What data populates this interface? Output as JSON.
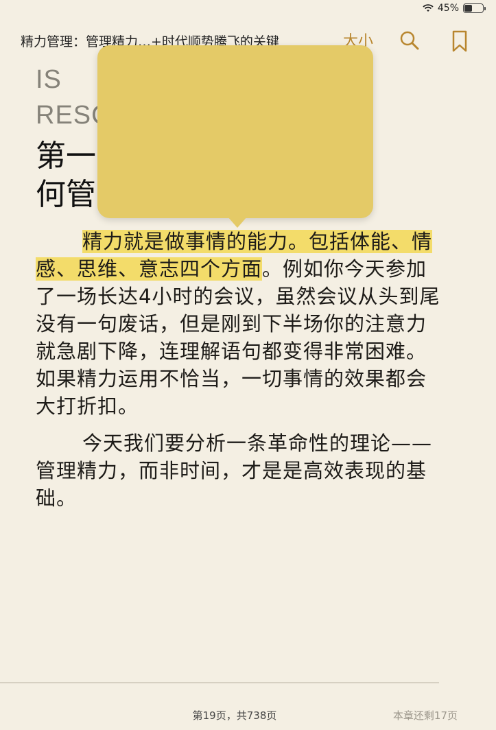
{
  "status": {
    "battery": "45%",
    "battery_level": 0.45
  },
  "header": {
    "book_title": "精力管理：管理精力…+时代顺势腾飞的关键",
    "font_size_label": "大小",
    "search_icon": "search-icon",
    "bookmark_icon": "bookmark-icon",
    "accent_color": "#b8862e"
  },
  "chapter": {
    "en_line1": "IS              IOUS",
    "en_line2": "RESC",
    "title_line1": "第一                  及如",
    "title_line2": "何管"
  },
  "body": {
    "p1_highlight": "精力就是做事情的能力。包括体能、情感、思维、意志四个方面",
    "p1_rest": "。例如你今天参加了一场长达4小时的会议，虽然会议从头到尾没有一句废话，但是刚到下半场你的注意力就急剧下降，连理解语句都变得非常困难。如果精力运用不恰当，一切事情的效果都会大打折扣。",
    "p2": "今天我们要分析一条革命性的理论——管理精力，而非时间，才是是高效表现的基础。",
    "highlight_color": "#f3dc6a"
  },
  "footer": {
    "page_info": "第19页，共738页",
    "remaining": "本章还剩17页"
  }
}
